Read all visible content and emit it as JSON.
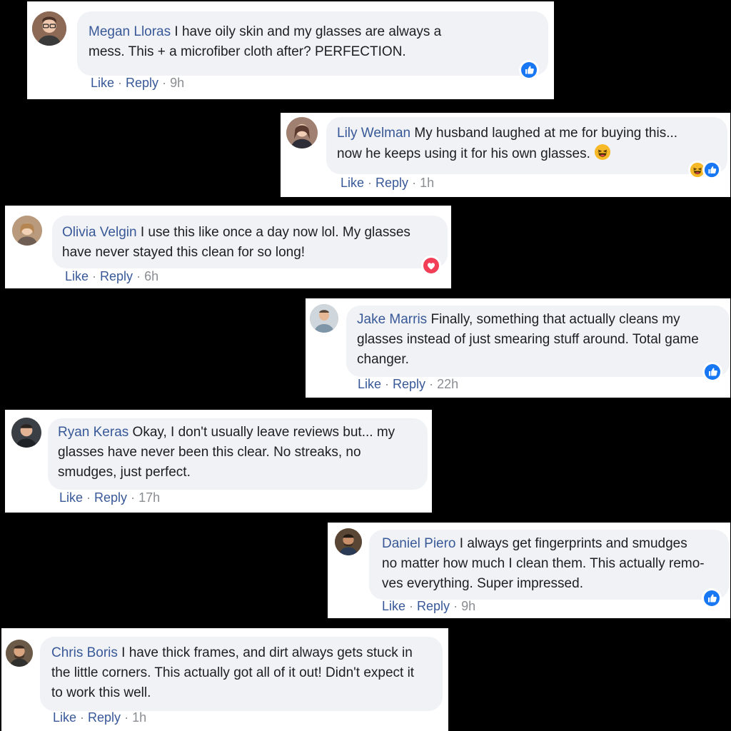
{
  "comments": [
    {
      "name": "Megan Lloras",
      "line1": " I have oily skin and my glasses are always a",
      "line2": "mess. This + a microfiber cloth after? PERFECTION.",
      "like": "Like",
      "reply": "Reply",
      "time": "9h",
      "reaction": "like-icon"
    },
    {
      "name": "Lily Welman",
      "line1": " My husband laughed at me for buying this...",
      "line2": "now he keeps using it for his own glasses. ",
      "like": "Like",
      "reply": "Reply",
      "time": "1h",
      "reaction": "haha-and-like-icons"
    },
    {
      "name": "Olivia Velgin",
      "line1": " I use this like once a day now lol. My glasses",
      "line2": "have never stayed this clean for so long!",
      "like": "Like",
      "reply": "Reply",
      "time": "6h",
      "reaction": "love-icon"
    },
    {
      "name": "Jake Marris",
      "line1": " Finally, something that actually cleans my",
      "line2": "glasses instead of just smearing stuff around. Total game",
      "line3": "changer.",
      "like": "Like",
      "reply": "Reply",
      "time": "22h",
      "reaction": "like-icon"
    },
    {
      "name": "Ryan Keras",
      "line1": " Okay, I don't usually leave reviews but... my",
      "line2": "glasses have never been this clear. No streaks, no",
      "line3": "smudges, just perfect.",
      "like": "Like",
      "reply": "Reply",
      "time": "17h"
    },
    {
      "name": "Daniel Piero",
      "line1": " I always get fingerprints and smudges",
      "line2": "no matter how much I clean them. This actually remo-",
      "line3": "ves everything. Super impressed.",
      "like": "Like",
      "reply": "Reply",
      "time": "9h",
      "reaction": "like-icon"
    },
    {
      "name": "Chris Boris",
      "line1": " I have thick frames, and dirt always gets stuck in",
      "line2": "the little corners. This actually got all of it out! Didn't expect it",
      "line3": "to work this well.",
      "like": "Like",
      "reply": "Reply",
      "time": "1h"
    }
  ],
  "separator": " · ",
  "colors": {
    "background": "#000000",
    "card": "#ffffff",
    "bubble": "#f0f2f5",
    "name": "#385898",
    "text": "#1c1e21",
    "meta": "#8a8d91",
    "like_blue": "#1877f2",
    "love_red": "#f33e58",
    "haha_yellow": "#f7b928"
  }
}
